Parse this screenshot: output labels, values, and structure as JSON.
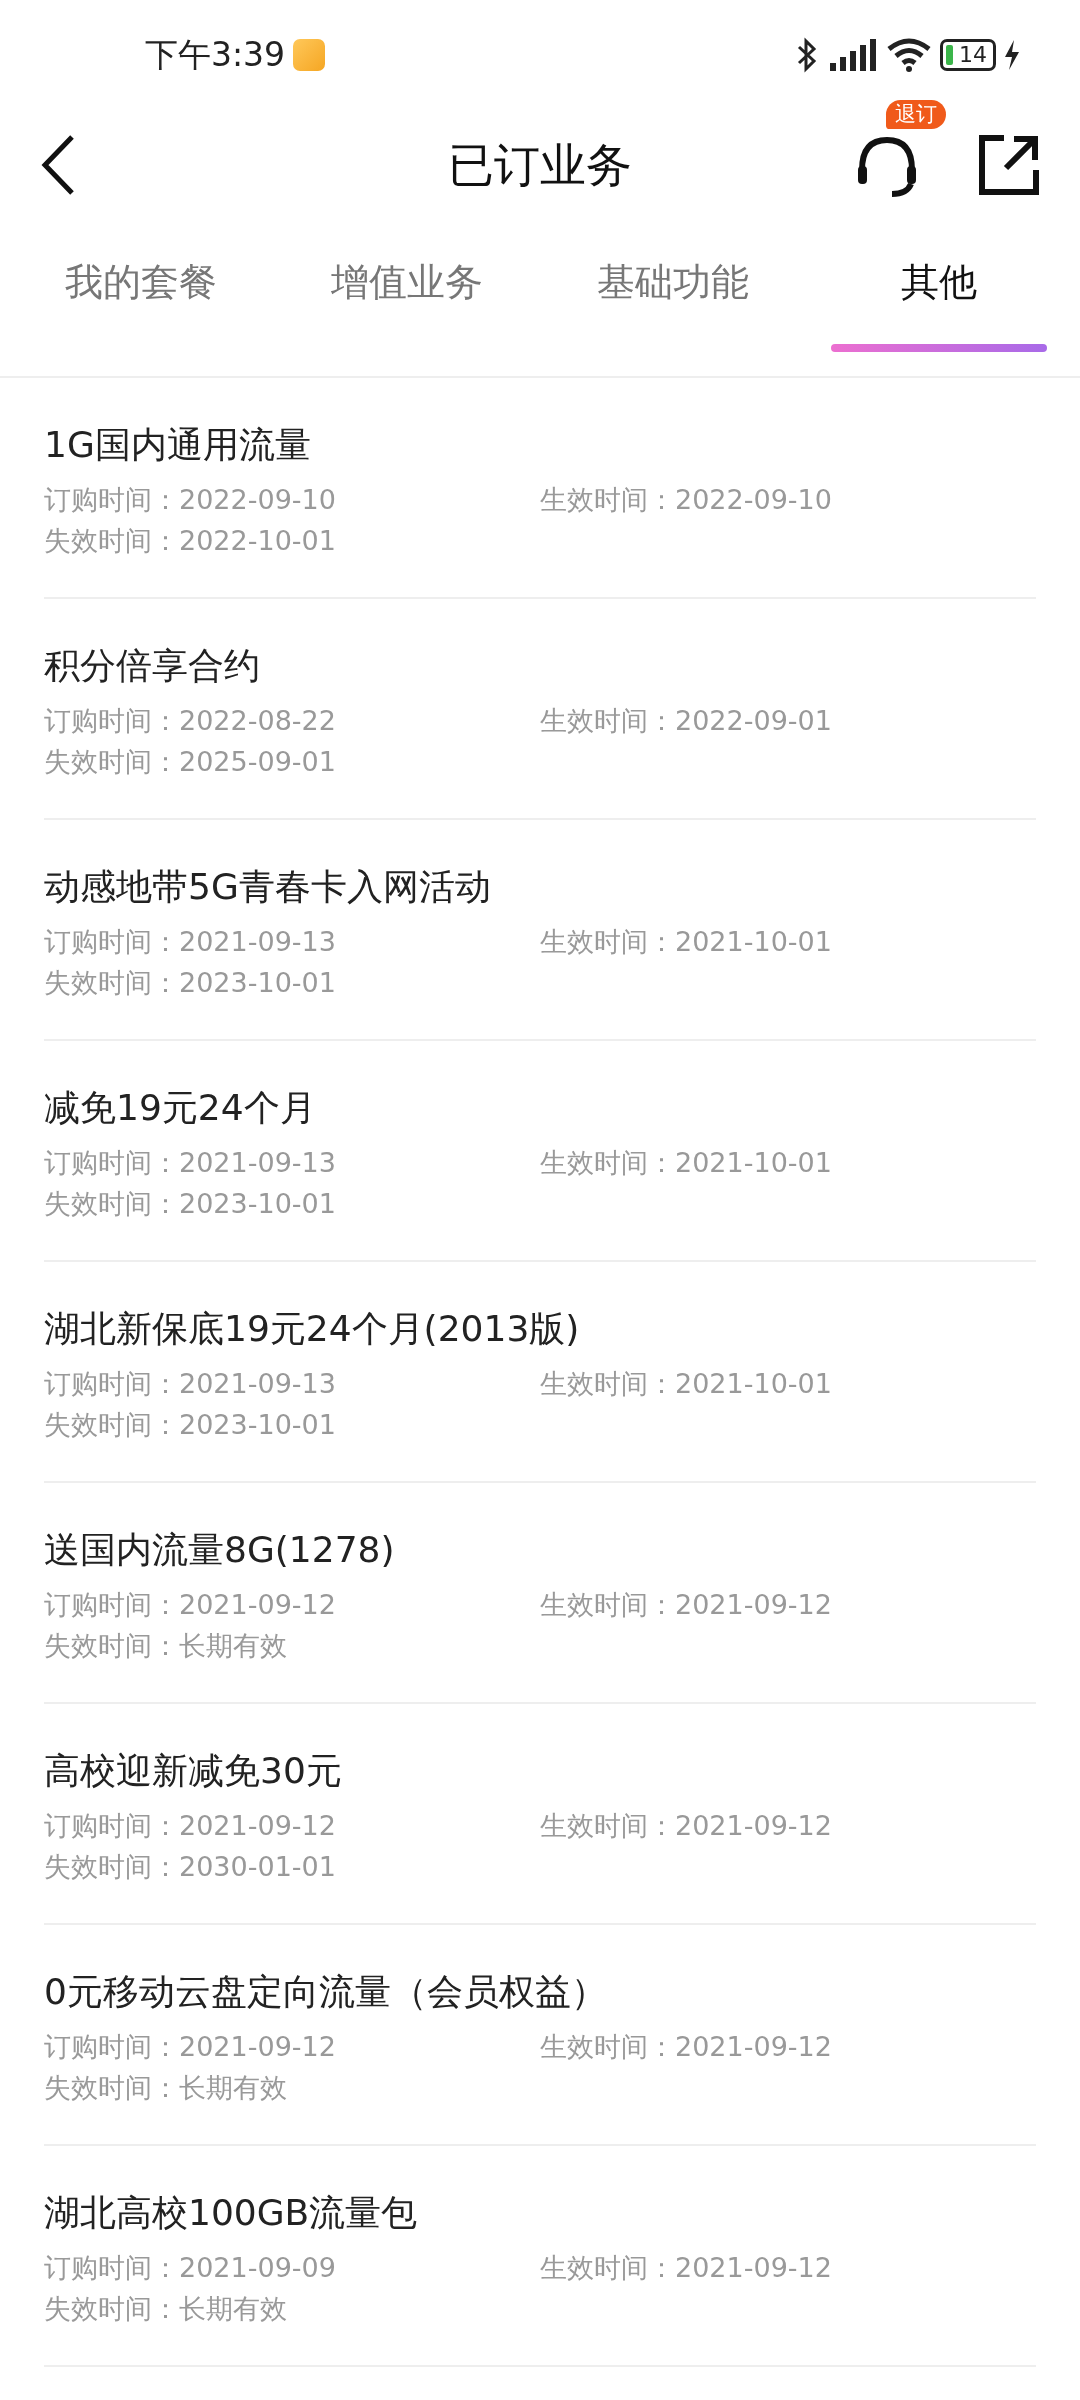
{
  "status_bar": {
    "time": "下午3:39",
    "battery": "14"
  },
  "header": {
    "title": "已订业务",
    "badge": "退订"
  },
  "tabs": [
    {
      "label": "我的套餐",
      "selected": false
    },
    {
      "label": "增值业务",
      "selected": false
    },
    {
      "label": "基础功能",
      "selected": false
    },
    {
      "label": "其他",
      "selected": true
    }
  ],
  "services": [
    {
      "name": "1G国内通用流量",
      "ordered": "订购时间：2022-09-10",
      "effective": "生效时间：2022-09-10",
      "expires": "失效时间：2022-10-01"
    },
    {
      "name": "积分倍享合约",
      "ordered": "订购时间：2022-08-22",
      "effective": "生效时间：2022-09-01",
      "expires": "失效时间：2025-09-01"
    },
    {
      "name": "动感地带5G青春卡入网活动",
      "ordered": "订购时间：2021-09-13",
      "effective": "生效时间：2021-10-01",
      "expires": "失效时间：2023-10-01"
    },
    {
      "name": "减免19元24个月",
      "ordered": "订购时间：2021-09-13",
      "effective": "生效时间：2021-10-01",
      "expires": "失效时间：2023-10-01"
    },
    {
      "name": "湖北新保底19元24个月(2013版)",
      "ordered": "订购时间：2021-09-13",
      "effective": "生效时间：2021-10-01",
      "expires": "失效时间：2023-10-01"
    },
    {
      "name": "送国内流量8G(1278)",
      "ordered": "订购时间：2021-09-12",
      "effective": "生效时间：2021-09-12",
      "expires": "失效时间：长期有效"
    },
    {
      "name": "高校迎新减免30元",
      "ordered": "订购时间：2021-09-12",
      "effective": "生效时间：2021-09-12",
      "expires": "失效时间：2030-01-01"
    },
    {
      "name": "0元移动云盘定向流量（会员权益）",
      "ordered": "订购时间：2021-09-12",
      "effective": "生效时间：2021-09-12",
      "expires": "失效时间：长期有效"
    },
    {
      "name": "湖北高校100GB流量包",
      "ordered": "订购时间：2021-09-09",
      "effective": "生效时间：2021-09-12",
      "expires": "失效时间：长期有效"
    }
  ]
}
